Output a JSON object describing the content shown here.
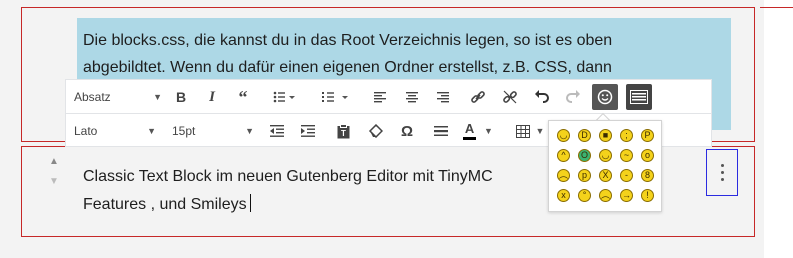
{
  "paragraph_block": {
    "line1": "Die blocks.css, die kannst du in das Root Verzeichnis legen, so ist es oben",
    "line2": "abgebildtet. Wenn du dafür einen eigenen Ordner erstellst, z.B. CSS, dann"
  },
  "classic_block": {
    "line1": "Classic Text Block im neuen Gutenberg Editor mit TinyMC",
    "line2": "Features , und Smileys"
  },
  "toolbar": {
    "format_select": "Absatz",
    "font_select": "Lato",
    "size_select": "15pt",
    "omega_label": "Ω",
    "text_color_label": "A"
  },
  "icons": {
    "bold": "bold-icon",
    "italic": "italic-icon",
    "quote": "blockquote-icon",
    "bullet_list": "bullet-list-icon",
    "numbered_list": "numbered-list-icon",
    "align_left": "align-left-icon",
    "align_center": "align-center-icon",
    "align_right": "align-right-icon",
    "link": "link-icon",
    "unlink": "unlink-icon",
    "undo": "undo-icon",
    "redo": "redo-icon",
    "emoticons": "emoticons-icon",
    "toolbar_toggle": "toolbar-toggle-icon",
    "outdent": "outdent-icon",
    "indent": "indent-icon",
    "paste_text": "paste-text-icon",
    "clear_format": "clear-formatting-icon",
    "special_char": "special-character-icon",
    "hr": "horizontal-line-icon",
    "text_color": "text-color-icon",
    "table": "table-icon",
    "more": "more-options-icon"
  },
  "emoticons": [
    "smile",
    "laugh",
    "cool",
    "wink",
    "tongue",
    "devil",
    "yell",
    "happy",
    "undecided",
    "surprised",
    "cry",
    "tongue-out",
    "angry",
    "embarrassed",
    "nerd",
    "sealed",
    "innocent",
    "frown",
    "arrow",
    "idea"
  ],
  "colors": {
    "highlight": "#add8e6",
    "block_border": "#c62828",
    "focus_border": "#2b2be0",
    "active_button": "#555555"
  }
}
